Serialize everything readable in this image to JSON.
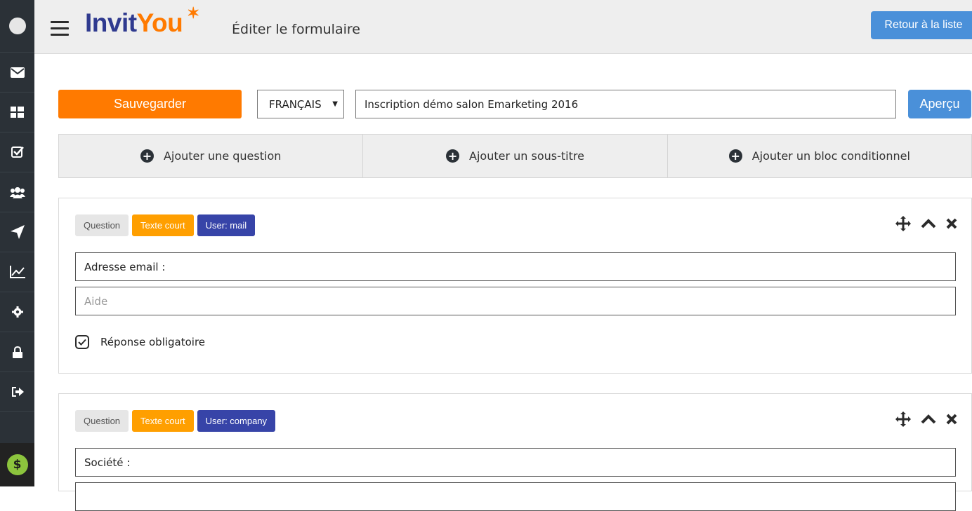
{
  "header": {
    "logo_part1": "Invit",
    "logo_part2": "You",
    "page_title": "Éditer le formulaire",
    "back_button": "Retour à la liste"
  },
  "sidebar": {
    "items": [
      {
        "icon": "envelope-icon"
      },
      {
        "icon": "grid-icon"
      },
      {
        "icon": "checkbox-icon"
      },
      {
        "icon": "users-icon"
      },
      {
        "icon": "paper-plane-icon"
      },
      {
        "icon": "chart-line-icon"
      },
      {
        "icon": "gear-icon"
      },
      {
        "icon": "lock-icon"
      },
      {
        "icon": "sign-out-icon"
      }
    ],
    "bottom_badge": "$"
  },
  "toolbar": {
    "save_label": "Sauvegarder",
    "language": "FRANÇAIS",
    "form_name": "Inscription démo salon Emarketing 2016",
    "preview_label": "Aperçu"
  },
  "add_bar": {
    "add_question": "Ajouter une question",
    "add_subtitle": "Ajouter un sous-titre",
    "add_conditional": "Ajouter un bloc conditionnel"
  },
  "questions": [
    {
      "tag_type": "Question",
      "tag_kind": "Texte court",
      "tag_user": "User: mail",
      "label": "Adresse email :",
      "help_placeholder": "Aide",
      "required_label": "Réponse obligatoire"
    },
    {
      "tag_type": "Question",
      "tag_kind": "Texte court",
      "tag_user": "User: company",
      "label": "Société :"
    }
  ],
  "colors": {
    "accent_orange": "#ff7a00",
    "accent_blue": "#4a90d9",
    "tag_user": "#3744a8",
    "tag_kind": "#ff9f00",
    "sidebar": "#2b3137"
  }
}
